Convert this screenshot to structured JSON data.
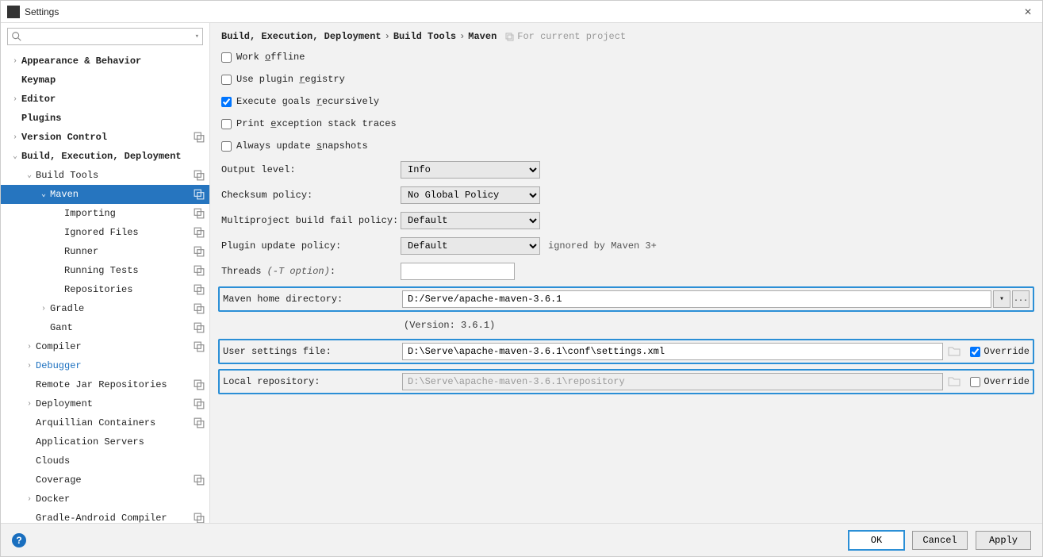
{
  "window": {
    "title": "Settings"
  },
  "search": {
    "placeholder": ""
  },
  "tree": [
    {
      "label": "Appearance & Behavior",
      "indent": 0,
      "arrow": "right",
      "bold": true
    },
    {
      "label": "Keymap",
      "indent": 0,
      "bold": true
    },
    {
      "label": "Editor",
      "indent": 0,
      "arrow": "right",
      "bold": true
    },
    {
      "label": "Plugins",
      "indent": 0,
      "bold": true
    },
    {
      "label": "Version Control",
      "indent": 0,
      "arrow": "right",
      "bold": true,
      "badge": true
    },
    {
      "label": "Build, Execution, Deployment",
      "indent": 0,
      "arrow": "down",
      "bold": true
    },
    {
      "label": "Build Tools",
      "indent": 1,
      "arrow": "down",
      "badge": true
    },
    {
      "label": "Maven",
      "indent": 2,
      "arrow": "down",
      "badge": true,
      "selected": true
    },
    {
      "label": "Importing",
      "indent": 3,
      "badge": true
    },
    {
      "label": "Ignored Files",
      "indent": 3,
      "badge": true
    },
    {
      "label": "Runner",
      "indent": 3,
      "badge": true
    },
    {
      "label": "Running Tests",
      "indent": 3,
      "badge": true
    },
    {
      "label": "Repositories",
      "indent": 3,
      "badge": true
    },
    {
      "label": "Gradle",
      "indent": 2,
      "arrow": "right",
      "badge": true
    },
    {
      "label": "Gant",
      "indent": 2,
      "badge": true
    },
    {
      "label": "Compiler",
      "indent": 1,
      "arrow": "right",
      "badge": true
    },
    {
      "label": "Debugger",
      "indent": 1,
      "arrow": "right",
      "blue": true
    },
    {
      "label": "Remote Jar Repositories",
      "indent": 1,
      "badge": true
    },
    {
      "label": "Deployment",
      "indent": 1,
      "arrow": "right",
      "badge": true
    },
    {
      "label": "Arquillian Containers",
      "indent": 1,
      "badge": true
    },
    {
      "label": "Application Servers",
      "indent": 1
    },
    {
      "label": "Clouds",
      "indent": 1
    },
    {
      "label": "Coverage",
      "indent": 1,
      "badge": true
    },
    {
      "label": "Docker",
      "indent": 1,
      "arrow": "right"
    },
    {
      "label": "Gradle-Android Compiler",
      "indent": 1,
      "badge": true
    }
  ],
  "breadcrumb": {
    "segments": [
      "Build, Execution, Deployment",
      "Build Tools",
      "Maven"
    ],
    "for_project": "For current project"
  },
  "checks": {
    "work_offline": {
      "pre": "Work ",
      "u": "o",
      "post": "ffline",
      "checked": false
    },
    "plugin_registry": {
      "pre": "Use plugin ",
      "u": "r",
      "post": "egistry",
      "checked": false
    },
    "execute_recursive": {
      "pre": "Execute goals ",
      "u": "r",
      "post": "ecursively",
      "checked": true
    },
    "print_exception": {
      "pre": "Print ",
      "u": "e",
      "post": "xception stack traces",
      "checked": false
    },
    "always_snapshots": {
      "pre": "Always update ",
      "u": "s",
      "post": "napshots",
      "checked": false
    }
  },
  "fields": {
    "output_level": {
      "label": "Output level:",
      "value": "Info"
    },
    "checksum_policy": {
      "label": "Checksum policy:",
      "value": "No Global Policy"
    },
    "multiproject": {
      "label": "Multiproject build fail policy:",
      "value": "Default"
    },
    "plugin_update": {
      "label": "Plugin update policy:",
      "value": "Default",
      "note": "ignored by Maven 3+"
    },
    "threads": {
      "label": "Threads ",
      "hint": "(-T option)",
      "suffix": ":",
      "value": ""
    },
    "maven_home": {
      "label": "Maven home directory:",
      "value": "D:/Serve/apache-maven-3.6.1"
    },
    "version": "(Version: 3.6.1)",
    "user_settings": {
      "label": "User settings file:",
      "value": "D:\\Serve\\apache-maven-3.6.1\\conf\\settings.xml",
      "override": true,
      "override_label": "Override"
    },
    "local_repo": {
      "label": "Local repository:",
      "value": "D:\\Serve\\apache-maven-3.6.1\\repository",
      "override": false,
      "override_label": "Override"
    }
  },
  "footer": {
    "ok": "OK",
    "cancel": "Cancel",
    "apply": "Apply"
  },
  "ellipsis": "..."
}
